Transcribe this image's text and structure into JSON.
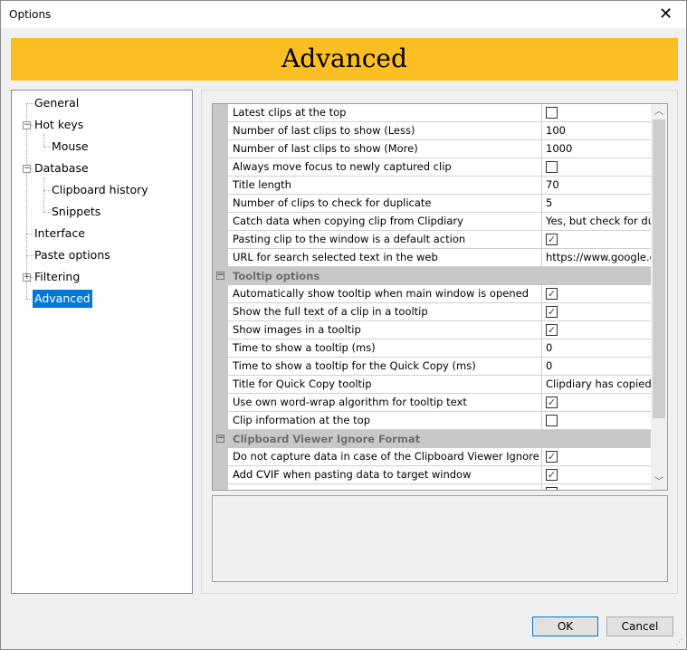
{
  "window": {
    "title": "Options",
    "close_icon": "close-icon"
  },
  "banner": {
    "title": "Advanced",
    "color": "#fbbf24"
  },
  "tree": {
    "items": [
      {
        "label": "General"
      },
      {
        "label": "Hot keys",
        "expanded": true
      },
      {
        "label": "Mouse"
      },
      {
        "label": "Database",
        "expanded": true
      },
      {
        "label": "Clipboard history"
      },
      {
        "label": "Snippets"
      },
      {
        "label": "Interface"
      },
      {
        "label": "Paste options"
      },
      {
        "label": "Filtering",
        "expanded": false
      },
      {
        "label": "Advanced",
        "selected": true
      }
    ]
  },
  "grid": {
    "rows": [
      {
        "label": "Latest clips at the top",
        "type": "checkbox",
        "checked": false
      },
      {
        "label": "Number of last clips to show (Less)",
        "value": "100"
      },
      {
        "label": "Number of last clips to show (More)",
        "value": "1000"
      },
      {
        "label": "Always move focus to newly captured clip",
        "type": "checkbox",
        "checked": false
      },
      {
        "label": "Title length",
        "value": "70"
      },
      {
        "label": "Number of clips to check for duplicate",
        "value": "5"
      },
      {
        "label": "Catch data when copying clip from Clipdiary",
        "value": "Yes, but check for duplicates"
      },
      {
        "label": "Pasting clip to the window is a default action",
        "type": "checkbox",
        "checked": true
      },
      {
        "label": "URL for search selected text in the web",
        "value": "https://www.google.com"
      },
      {
        "category": "Tooltip options"
      },
      {
        "label": "Automatically show tooltip when main window is opened",
        "type": "checkbox",
        "checked": true
      },
      {
        "label": "Show the full text of a clip in a tooltip",
        "type": "checkbox",
        "checked": true
      },
      {
        "label": "Show images in a tooltip",
        "type": "checkbox",
        "checked": true
      },
      {
        "label": "Time to show a tooltip (ms)",
        "value": "0"
      },
      {
        "label": "Time to show a tooltip for the Quick Copy (ms)",
        "value": "0"
      },
      {
        "label": "Title for Quick Copy tooltip",
        "value": "    Clipdiary has copied"
      },
      {
        "label": "Use own word-wrap algorithm for tooltip text",
        "type": "checkbox",
        "checked": true
      },
      {
        "label": "Clip information at the top",
        "type": "checkbox",
        "checked": false
      },
      {
        "category": "Clipboard Viewer Ignore Format"
      },
      {
        "label": "Do not capture data in case of the Clipboard Viewer Ignore Format",
        "type": "checkbox",
        "checked": true
      },
      {
        "label": "Add CVIF when pasting data to target window",
        "type": "checkbox",
        "checked": true
      },
      {
        "label": "",
        "type": "checkbox",
        "checked": false
      }
    ]
  },
  "description": "",
  "buttons": {
    "ok": "OK",
    "cancel": "Cancel"
  }
}
